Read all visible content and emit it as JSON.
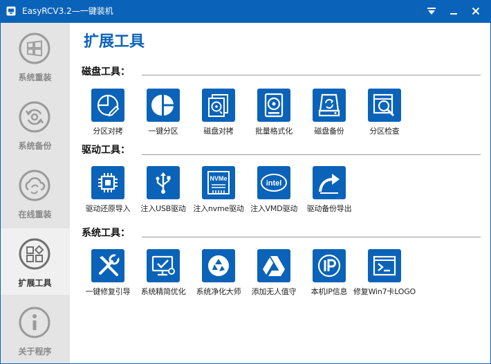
{
  "window": {
    "title": "EasyRCV3.2—一键装机",
    "accent_color": "#0a63b8",
    "icons": [
      "app-icon",
      "dropdown-arrow-icon",
      "minimize-icon",
      "close-icon"
    ]
  },
  "sidebar": {
    "items": [
      {
        "label": "系统重装",
        "icon": "windows-logo-icon",
        "active": false
      },
      {
        "label": "系统备份",
        "icon": "backup-refresh-icon",
        "active": false
      },
      {
        "label": "在线重装",
        "icon": "cloud-sync-icon",
        "active": false
      },
      {
        "label": "扩展工具",
        "icon": "apps-grid-icon",
        "active": true
      },
      {
        "label": "关于程序",
        "icon": "info-icon",
        "active": false
      }
    ]
  },
  "main": {
    "title": "扩展工具",
    "sections": [
      {
        "label": "磁盘工具：",
        "tools": [
          {
            "label": "分区对拷",
            "icon": "partition-copy-icon"
          },
          {
            "label": "一键分区",
            "icon": "pie-partition-icon"
          },
          {
            "label": "磁盘对拷",
            "icon": "disk-clone-icon"
          },
          {
            "label": "批量格式化",
            "icon": "batch-format-icon"
          },
          {
            "label": "磁盘备份",
            "icon": "disk-backup-icon"
          },
          {
            "label": "分区检查",
            "icon": "partition-check-icon"
          }
        ]
      },
      {
        "label": "驱动工具：",
        "tools": [
          {
            "label": "驱动还原导入",
            "icon": "chip-icon"
          },
          {
            "label": "注入USB驱动",
            "icon": "usb-icon"
          },
          {
            "label": "注入nvme驱动",
            "icon": "nvme-icon"
          },
          {
            "label": "注入VMD驱动",
            "icon": "intel-icon"
          },
          {
            "label": "驱动备份导出",
            "icon": "share-arrow-icon"
          }
        ]
      },
      {
        "label": "系统工具：",
        "tools": [
          {
            "label": "一键修复引导",
            "icon": "repair-tools-icon"
          },
          {
            "label": "系统精简优化",
            "icon": "optimize-monitor-icon"
          },
          {
            "label": "系统净化大师",
            "icon": "cleanup-cycle-icon"
          },
          {
            "label": "添加无人值守",
            "icon": "drive-triangle-icon"
          },
          {
            "label": "本机IP信息",
            "icon": "ip-icon"
          },
          {
            "label": "修复Win7卡LOGO",
            "icon": "terminal-icon"
          }
        ]
      }
    ]
  }
}
